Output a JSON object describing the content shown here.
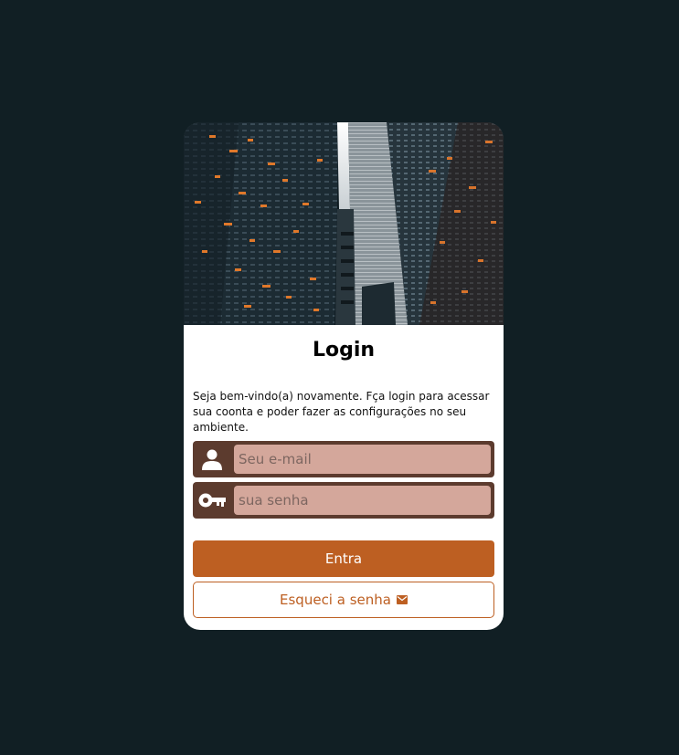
{
  "login": {
    "title": "Login",
    "description": "Seja bem-vindo(a) novamente. Fça login para acessar sua coonta e poder fazer as configurações no seu ambiente.",
    "email_placeholder": "Seu e-mail",
    "password_placeholder": "sua senha",
    "submit_label": "Entra",
    "forgot_label": "Esqueci a senha"
  },
  "icons": {
    "email_field": "user-icon",
    "password_field": "key-icon",
    "forgot_button": "envelope-icon",
    "header": "skyscrapers-photo"
  },
  "colors": {
    "page_background": "#111f24",
    "card_background": "#ffffff",
    "field_frame": "#5c3b2e",
    "field_input": "#d4a79b",
    "accent": "#bd5f22"
  }
}
